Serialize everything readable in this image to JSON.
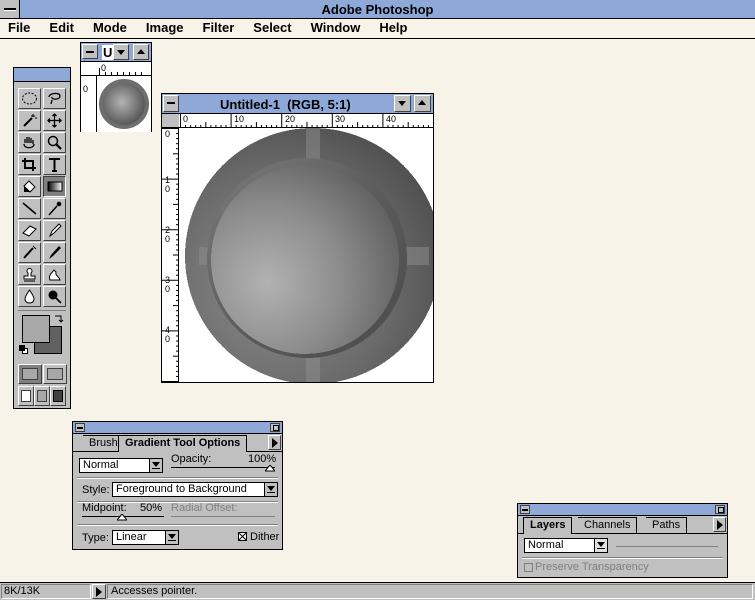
{
  "app": {
    "title": "Adobe Photoshop"
  },
  "menu": [
    "File",
    "Edit",
    "Mode",
    "Image",
    "Filter",
    "Select",
    "Window",
    "Help"
  ],
  "navigator": {
    "title": "U",
    "ruler_zero": "0"
  },
  "document": {
    "title": "Untitled-1  (RGB, 5:1)",
    "h_ticks": [
      "0",
      "10",
      "20",
      "30",
      "40"
    ],
    "v_ticks": [
      "0",
      "1 0",
      "2 0",
      "3 0",
      "4 0"
    ]
  },
  "gradient_options": {
    "tab_brush": "Brush",
    "tab_active": "Gradient Tool Options",
    "mode_value": "Normal",
    "opacity_label": "Opacity:",
    "opacity_value": "100%",
    "style_label": "Style:",
    "style_value": "Foreground to Background",
    "midpoint_label": "Midpoint:",
    "midpoint_value": "50%",
    "radial_offset_label": "Radial Offset:",
    "type_label": "Type:",
    "type_value": "Linear",
    "dither_label": "Dither",
    "dither_checked": true
  },
  "layers": {
    "tabs": [
      "Layers",
      "Channels",
      "Paths"
    ],
    "mode_value": "Normal",
    "preserve_label": "Preserve Transparency"
  },
  "status": {
    "doc_size": "8K/13K",
    "message": "Accesses pointer."
  },
  "colors": {
    "title_bar": "#8ea8d8",
    "desktop": "#f7f3e8",
    "panel": "#c0c0c0",
    "foreground_swatch": "#a8a8a8",
    "background_swatch": "#606060"
  }
}
